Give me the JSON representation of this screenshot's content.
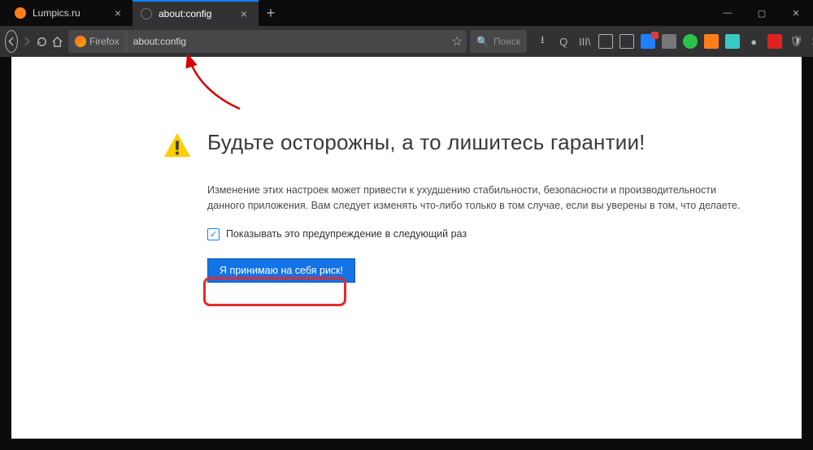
{
  "tabs": [
    {
      "label": "Lumpics.ru",
      "active": false
    },
    {
      "label": "about:config",
      "active": true
    }
  ],
  "url": {
    "identity_label": "Firefox",
    "value": "about:config"
  },
  "search": {
    "placeholder": "Поиск"
  },
  "content": {
    "title": "Будьте осторожны, а то лишитесь гарантии!",
    "body": "Изменение этих настроек может привести к ухудшению стабильности, безопасности и производительности данного приложения. Вам следует изменять что-либо только в том случае, если вы уверены в том, что делаете.",
    "checkbox_label": "Показывать это предупреждение в следующий раз",
    "accept_label": "Я принимаю на себя риск!"
  }
}
